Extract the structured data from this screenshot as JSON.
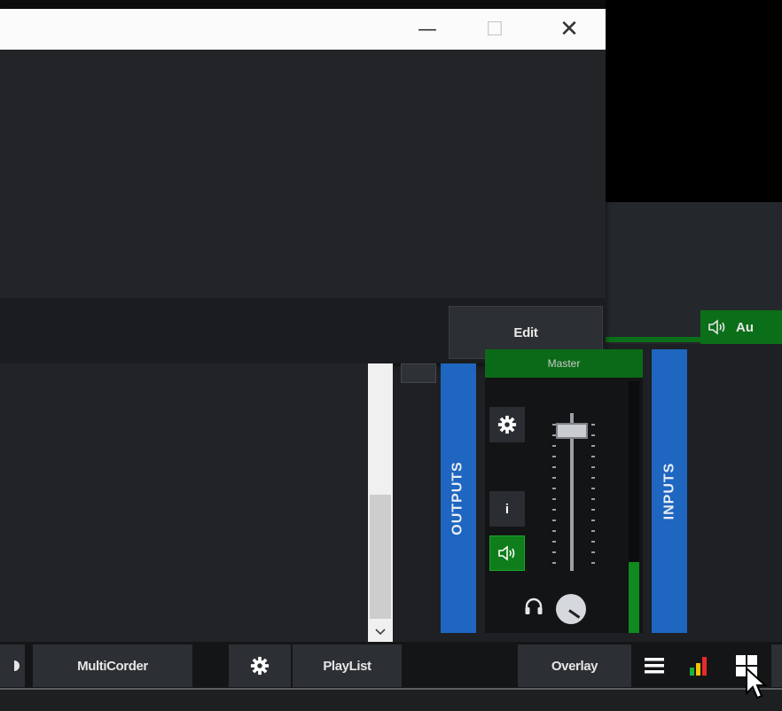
{
  "window": {
    "minimize_glyph": "—",
    "maximize_glyph": "☐",
    "close_glyph": "✕"
  },
  "dialog": {
    "edit_label": "Edit"
  },
  "audio_strip": {
    "icon": "speaker-icon",
    "label": "Au"
  },
  "mixer": {
    "outputs_label": "OUTPUTS",
    "inputs_label": "INPUTS",
    "master_label": "Master",
    "info_label": "i",
    "fader_level": 0.93,
    "meter_level": 0.28
  },
  "toolbar": {
    "multicorder_label": "MultiCorder",
    "playlist_label": "PlayList",
    "overlay_label": "Overlay"
  },
  "colors": {
    "accent_blue": "#1e66c0",
    "accent_green": "#0b6f1a"
  }
}
